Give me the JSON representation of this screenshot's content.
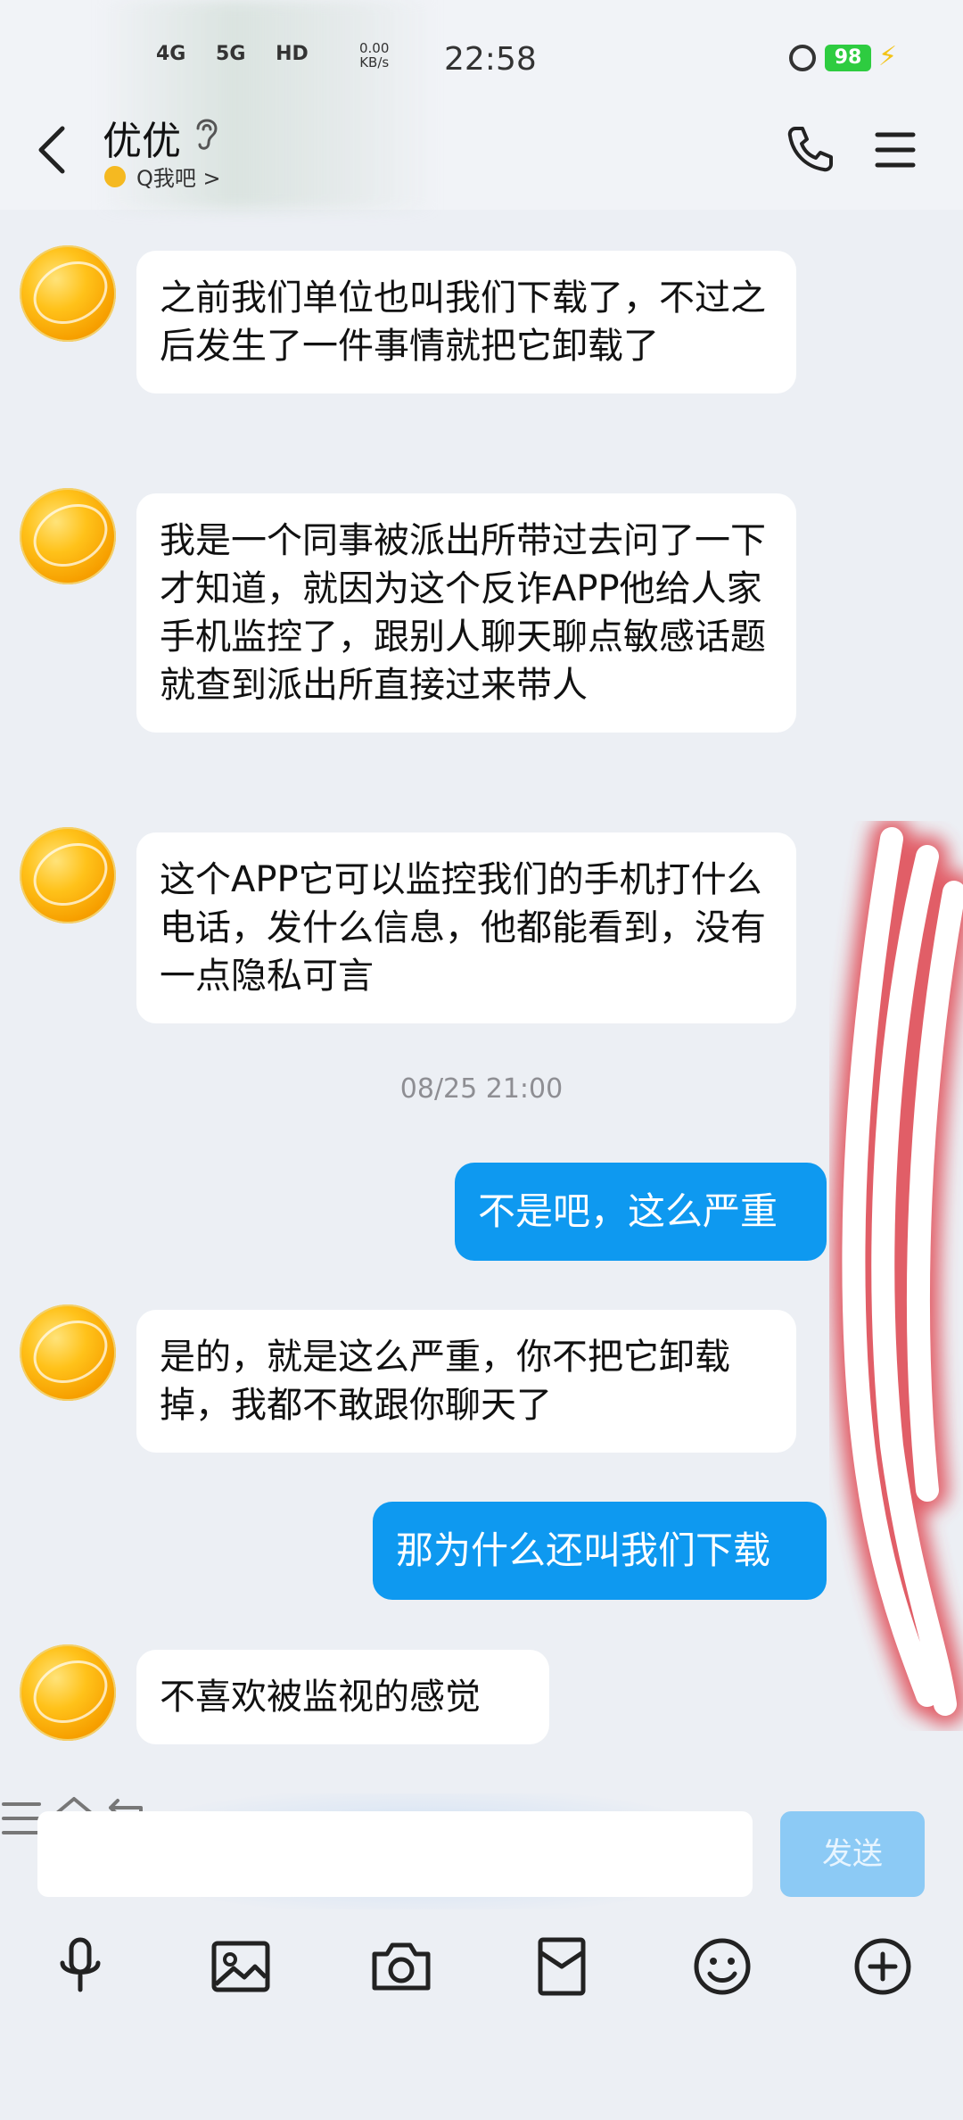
{
  "status_bar": {
    "net1": "4G",
    "net2": "5G",
    "net3": "HD",
    "speed_value": "0.00",
    "speed_unit": "KB/s",
    "time": "22:58",
    "battery": "98"
  },
  "header": {
    "contact_name": "优优",
    "subline": "Q我吧 >"
  },
  "messages": [
    {
      "dir": "in",
      "text": "之前我们单位也叫我们下载了，不过之后发生了一件事情就把它卸载了"
    },
    {
      "dir": "in",
      "text": "我是一个同事被派出所带过去问了一下才知道，就因为这个反诈APP他给人家手机监控了，跟别人聊天聊点敏感话题就查到派出所直接过来带人"
    },
    {
      "dir": "in",
      "text": "这个APP它可以监控我们的手机打什么电话，发什么信息，他都能看到，没有一点隐私可言"
    },
    {
      "dir": "time",
      "text": "08/25 21:00"
    },
    {
      "dir": "out",
      "text": "不是吧，这么严重"
    },
    {
      "dir": "in",
      "text": "是的，就是这么严重，你不把它卸载掉，我都不敢跟你聊天了"
    },
    {
      "dir": "out",
      "text": "那为什么还叫我们下载"
    },
    {
      "dir": "in",
      "text": "不喜欢被监视的感觉"
    }
  ],
  "composer": {
    "input_value": "",
    "send_label": "发送"
  },
  "toolbar_icons": [
    "microphone-icon",
    "image-icon",
    "camera-icon",
    "red-packet-icon",
    "emoji-icon",
    "plus-icon"
  ],
  "nav_icons": [
    "recents-icon",
    "home-icon",
    "back-nav-icon"
  ],
  "colors": {
    "outgoing_bubble": "#0e99f0",
    "incoming_bubble": "#ffffff",
    "chat_background": "#eceff4",
    "send_button": "#8ccaf5",
    "battery": "#2ecc40"
  }
}
